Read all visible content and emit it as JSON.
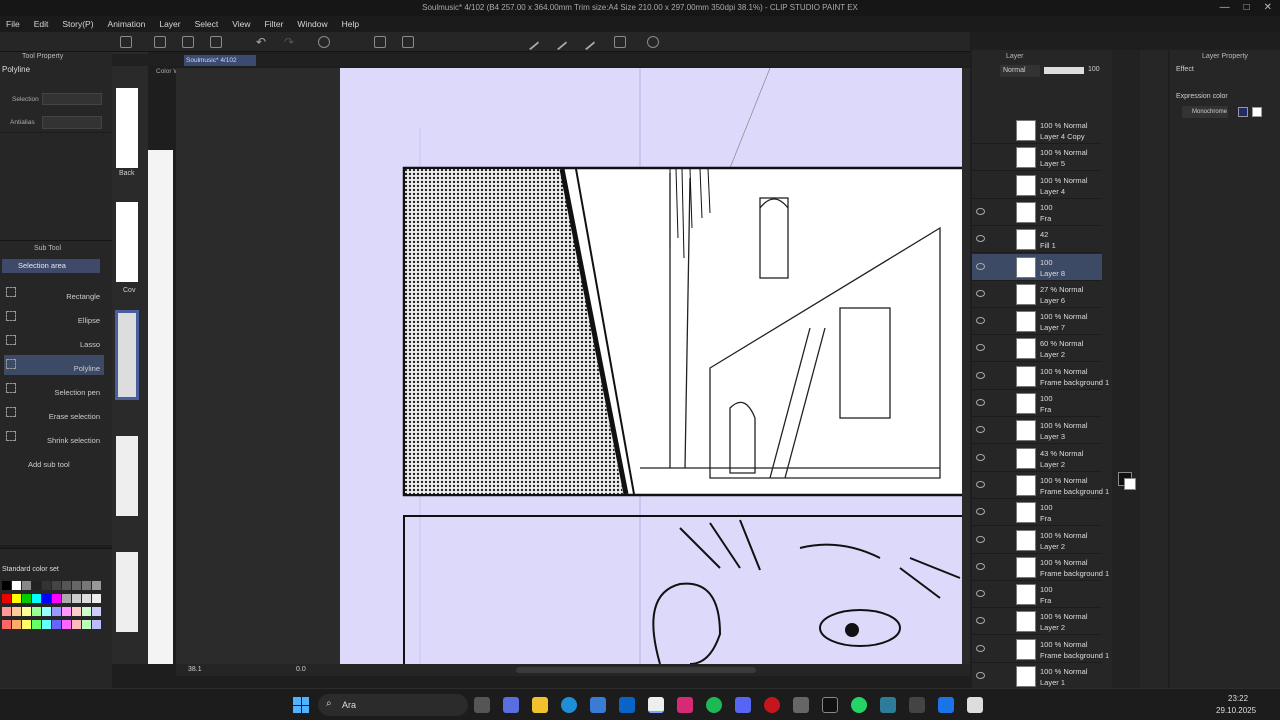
{
  "window": {
    "title": "Soulmusic* 4/102 (B4 257.00 x 364.00mm Trim size:A4 Size 210.00 x 297.00mm 350dpi 38.1%) - CLIP STUDIO PAINT EX"
  },
  "menu": [
    "File",
    "Edit",
    "Story(P)",
    "Animation",
    "Layer",
    "Select",
    "View",
    "Filter",
    "Window",
    "Help"
  ],
  "tool_property": {
    "tab": "Tool Property",
    "tool": "Polyline",
    "selection_label": "Selection",
    "antialias_label": "Antialias"
  },
  "sub_tool": {
    "tab": "Sub Tool",
    "group": "Selection area",
    "items": [
      "Rectangle",
      "Ellipse",
      "Lasso",
      "Polyline",
      "Selection pen",
      "Erase selection",
      "Shrink selection"
    ],
    "add": "Add sub tool"
  },
  "color_set": {
    "name": "Standard color set"
  },
  "page_manager": {
    "labels": [
      "Back",
      "Cov"
    ]
  },
  "tabs": {
    "document": "Soulmusic* 4/102",
    "color_wheel": "Color Wheel"
  },
  "status": {
    "zoom": "38.1",
    "angle": "0.0"
  },
  "layer_panel": {
    "tab": "Layer",
    "blend": "Normal",
    "opacity": "100",
    "layers": [
      {
        "pct": "100 % Normal",
        "name": "Layer 4 Copy"
      },
      {
        "pct": "100 % Normal",
        "name": "Layer 5"
      },
      {
        "pct": "100 % Normal",
        "name": "Layer 4"
      },
      {
        "pct": "100",
        "name": "Fra"
      },
      {
        "pct": "42",
        "name": "Fill 1"
      },
      {
        "pct": "100",
        "name": "Layer 8"
      },
      {
        "pct": "27 % Normal",
        "name": "Layer 6"
      },
      {
        "pct": "100 % Normal",
        "name": "Layer 7"
      },
      {
        "pct": "60 % Normal",
        "name": "Layer 2"
      },
      {
        "pct": "100 % Normal",
        "name": "Frame background 1"
      },
      {
        "pct": "100",
        "name": "Fra"
      },
      {
        "pct": "100 % Normal",
        "name": "Layer 3"
      },
      {
        "pct": "43 % Normal",
        "name": "Layer 2"
      },
      {
        "pct": "100 % Normal",
        "name": "Frame background 1"
      },
      {
        "pct": "100",
        "name": "Fra"
      },
      {
        "pct": "100 % Normal",
        "name": "Layer 2"
      },
      {
        "pct": "100 % Normal",
        "name": "Frame background 1"
      },
      {
        "pct": "100",
        "name": "Fra"
      },
      {
        "pct": "100 % Normal",
        "name": "Layer 2"
      },
      {
        "pct": "100 % Normal",
        "name": "Frame background 1"
      },
      {
        "pct": "100 % Normal",
        "name": "Layer 1"
      }
    ]
  },
  "layer_property": {
    "tab": "Layer Property",
    "effect": "Effect",
    "expression_color": "Expression color",
    "mode": "Monochrome"
  },
  "taskbar": {
    "search": "Ara",
    "time": "23:22",
    "date": "29.10.2025"
  }
}
